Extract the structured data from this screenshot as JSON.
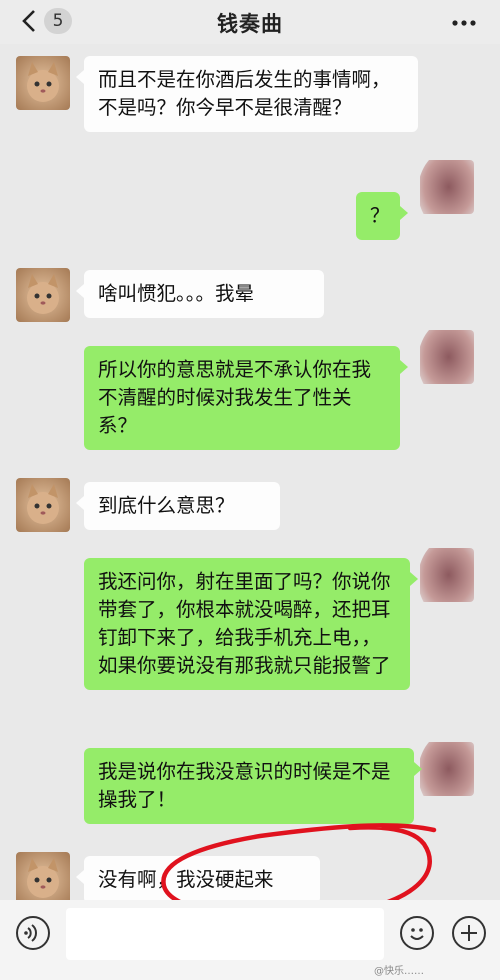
{
  "header": {
    "title": "钱奏曲",
    "unread_count": "5",
    "back_icon": "chevron-left-icon",
    "more_icon": "ellipsis-icon"
  },
  "messages": [
    {
      "side": "in",
      "text": "而且不是在你酒后发生的事情啊，不是吗？你今早不是很清醒？"
    },
    {
      "side": "out",
      "text": "？"
    },
    {
      "side": "in",
      "text": "啥叫惯犯。。。我晕"
    },
    {
      "side": "out",
      "text": "所以你的意思就是不承认你在我不清醒的时候对我发生了性关系？"
    },
    {
      "side": "in",
      "text": "到底什么意思？"
    },
    {
      "side": "out",
      "text": "我还问你，射在里面了吗？你说你带套了，你根本就没喝醉，还把耳钉卸下来了，给我手机充上电，，如果你要说没有那我就只能报警了"
    },
    {
      "side": "out",
      "text": "我是说你在我没意识的时候是不是操我了！"
    },
    {
      "side": "in",
      "text": "没有啊，我没硬起来"
    }
  ],
  "input_bar": {
    "voice_icon": "voice-icon",
    "emoji_icon": "emoji-icon",
    "plus_icon": "plus-icon",
    "text_value": ""
  },
  "watermark": "@快乐……"
}
